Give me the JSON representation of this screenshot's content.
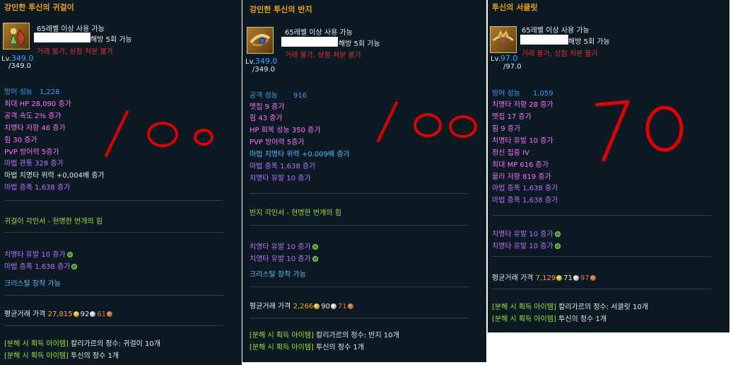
{
  "panels": [
    {
      "title": "강인한 투신의 귀걸이",
      "icon": "earring-icon",
      "requirement": "65레벨 이상 사용 가능",
      "seal": "해방 5회 가능",
      "trade": "거래 불가, 상점 처분 불가",
      "lv_label": "Lv.",
      "lv_current": "349.0",
      "lv_max": "/349.0",
      "stats": [
        {
          "label": "방어 성능",
          "value": "1,228",
          "color": "blue"
        },
        {
          "label": "최대 HP 28,090 증가",
          "color": "pink"
        },
        {
          "label": "공격 속도 2% 증가",
          "color": "pink"
        },
        {
          "label": "치명타 저항 46 증가",
          "color": "pink"
        },
        {
          "label": "힘 30 증가",
          "color": "pink"
        },
        {
          "label": "PVP 방어력 5증가",
          "color": "pink"
        },
        {
          "label": "마법 관통 328 증가",
          "color": "purple"
        },
        {
          "label": "마법 치명타 위력 +0,004배 증가",
          "color": "white"
        },
        {
          "label": "마법 증폭 1,638 증가",
          "color": "purple"
        }
      ],
      "engrave": "귀걸이 각인서 - 현명한 번개의 힘",
      "rune_stats": [
        "치명타 유발 10 증가",
        "마법 증폭 1,638 증가"
      ],
      "crystal": "크리스탈 장착 가능",
      "price_label": "평균거래 가격",
      "price_gold": "27,815",
      "price_silver": "92",
      "price_copper": "61",
      "disassemble": [
        {
          "tag": "[분해 시 획득 아이템]",
          "text": "칼리가르의 정수: 귀걸이 10개"
        },
        {
          "tag": "[분해 시 획득 아이템]",
          "text": "투신의 정수 1개"
        }
      ],
      "annotation": "100"
    },
    {
      "title": "강인한 투신의 반지",
      "icon": "ring-icon",
      "requirement": "65레벨 이상 사용 가능",
      "seal": "해방 5회 가능",
      "trade": "거래 불가, 상점 처분 불가",
      "lv_label": "Lv.",
      "lv_current": "349.0",
      "lv_max": "/349.0",
      "stats": [
        {
          "label": "공격 성능",
          "value": "916",
          "color": "blue"
        },
        {
          "label": "맷집 9 증가",
          "color": "pink"
        },
        {
          "label": "힘 43 증가",
          "color": "pink"
        },
        {
          "label": "HP 회복 성능 350 증가",
          "color": "pink"
        },
        {
          "label": "PVP 방어력 5증가",
          "color": "pink"
        },
        {
          "label": "마법 치명타 위력 +0.009배 증가",
          "color": "ltblue"
        },
        {
          "label": "마법 증폭 1,638 증가",
          "color": "purple"
        },
        {
          "label": "치명타 유발 10 증가",
          "color": "purple"
        }
      ],
      "engrave": "반지 각인서 - 현명한 번개의 힘",
      "rune_stats": [
        "치명타 유발 10 증가",
        "치명타 유발 10 증가"
      ],
      "crystal": "크리스탈 장착 가능",
      "price_label": "평균거래 가격",
      "price_gold": "2,266",
      "price_silver": "90",
      "price_copper": "71",
      "disassemble": [
        {
          "tag": "[분해 시 획득 아이템]",
          "text": "칼리가르의 정수: 반지 10개"
        },
        {
          "tag": "[분해 시 획득 아이템]",
          "text": "투신의 정수 1개"
        }
      ],
      "annotation": "100"
    },
    {
      "title": "투신의 서클릿",
      "icon": "circlet-icon",
      "requirement": "65레벨 이상 사용 가능",
      "seal": "해방 5회 가능",
      "trade": "거래 불가, 상점 처분 불가",
      "lv_label": "Lv.",
      "lv_current": "97.0",
      "lv_max": "/97.0",
      "stats": [
        {
          "label": "방어 성능",
          "value": "1,059",
          "color": "blue"
        },
        {
          "label": "치명타 저항 28 증가",
          "color": "pink"
        },
        {
          "label": "맷집 17 증가",
          "color": "pink"
        },
        {
          "label": "힘 9 증가",
          "color": "pink"
        },
        {
          "label": "치명타 유발 10 증가",
          "color": "pink"
        },
        {
          "label": "정신 집중 IV",
          "color": "pink"
        },
        {
          "label": "최대 MP 616 증가",
          "color": "pink"
        },
        {
          "label": "물리 저항 819 증가",
          "color": "pink"
        },
        {
          "label": "마법 증폭 1,638 증가",
          "color": "purple"
        },
        {
          "label": "마법 증폭 1,638 증가",
          "color": "purple"
        }
      ],
      "rune_stats": [
        "치명타 유발 10 증가",
        "치명타 유발 10 증가"
      ],
      "price_label": "평균거래 가격",
      "price_gold": "7,129",
      "price_silver": "71",
      "price_copper": "97",
      "disassemble": [
        {
          "tag": "[분해 시 획득 아이템]",
          "text": "칼리가르의 정수: 서클릿 10개"
        },
        {
          "tag": "[분해 시 획득 아이템]",
          "text": "투신의 정수 1개"
        }
      ],
      "annotation": "70"
    }
  ]
}
